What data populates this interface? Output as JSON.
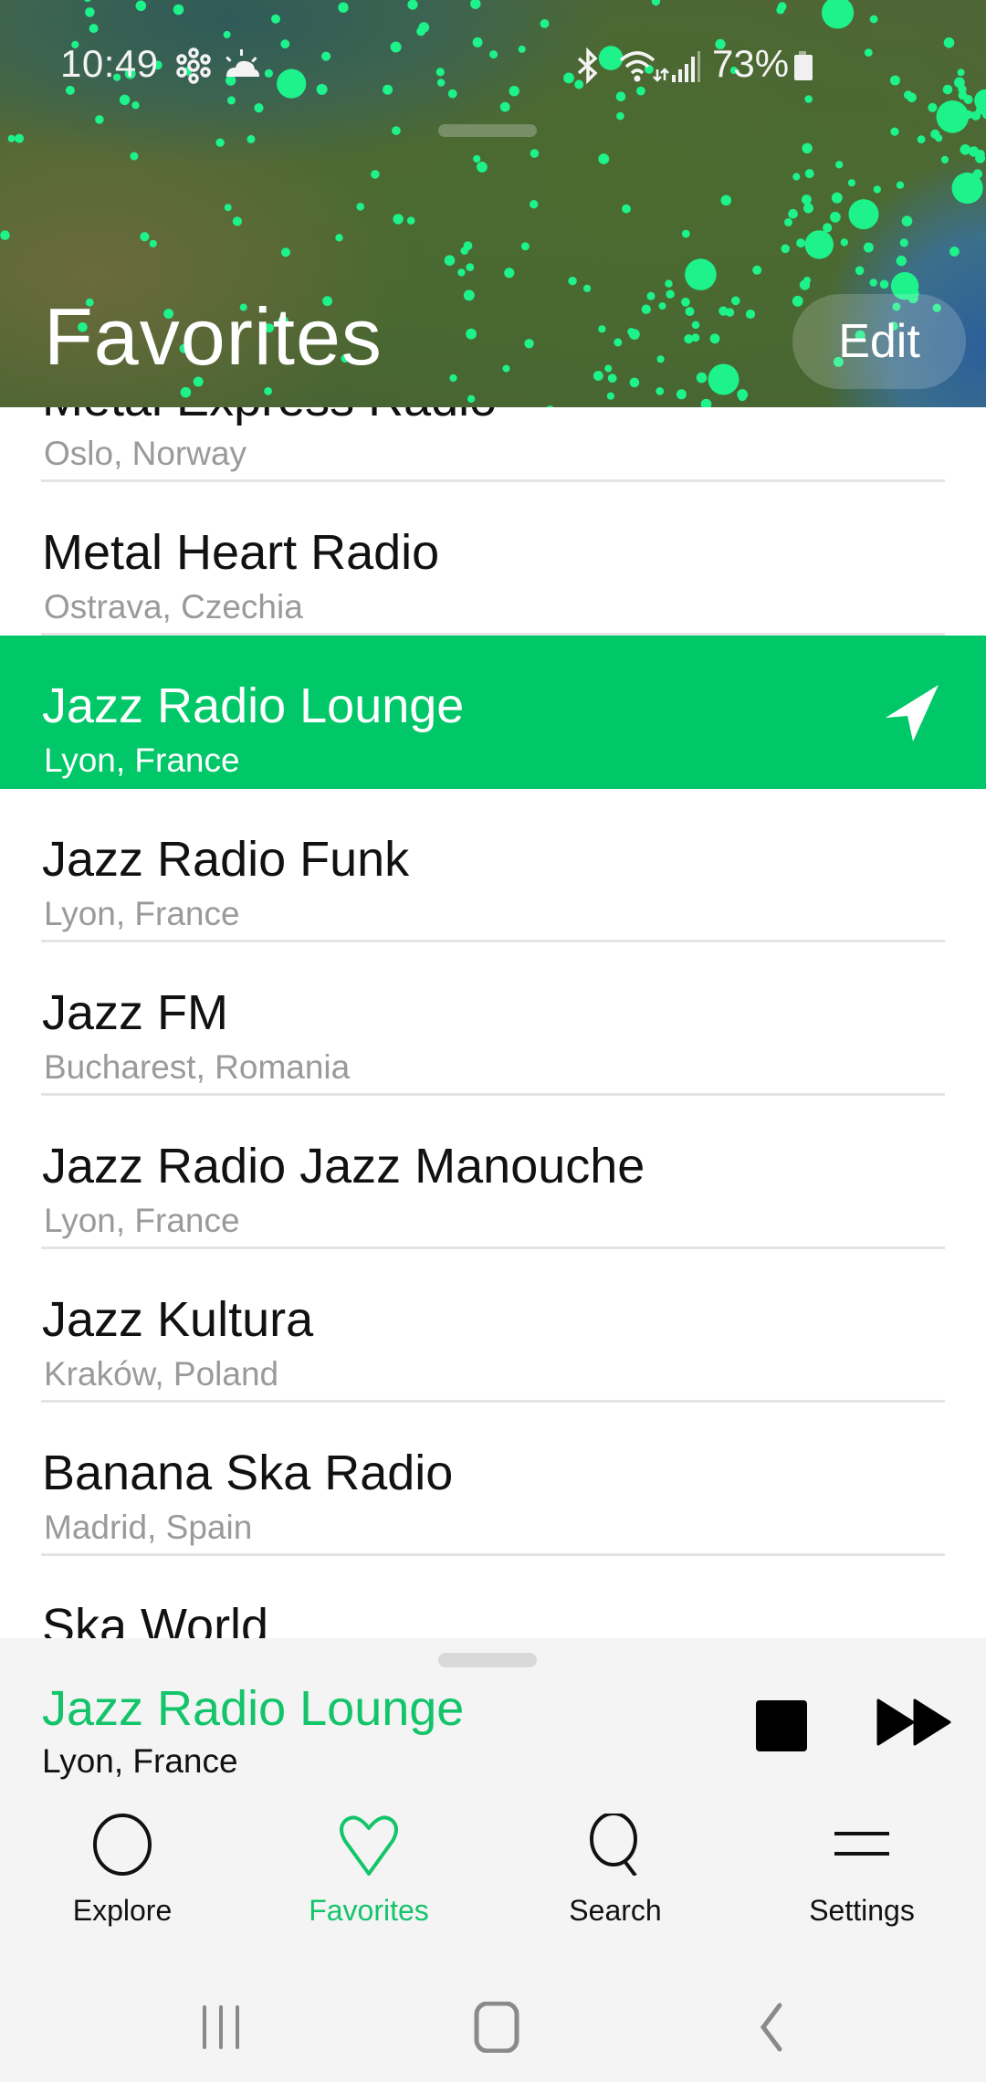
{
  "status_bar": {
    "time": "10:49",
    "left_icons": [
      "pinwheel-icon",
      "weather-sun-cloud-icon"
    ],
    "right_icons": [
      "bluetooth-icon",
      "wifi-data-icon",
      "signal-icon",
      "battery-icon"
    ],
    "battery_percent": "73%"
  },
  "header": {
    "title": "Favorites",
    "edit_label": "Edit",
    "background": "satellite-map-with-station-dots"
  },
  "colors": {
    "accent": "#00C767",
    "accent_text": "#14C46A",
    "map_dot": "#1EF28A"
  },
  "stations": [
    {
      "name": "Metal Express Radio",
      "location": "Oslo, Norway",
      "active": false
    },
    {
      "name": "Metal Heart Radio",
      "location": "Ostrava, Czechia",
      "active": false
    },
    {
      "name": "Jazz Radio Lounge",
      "location": "Lyon, France",
      "active": true,
      "icon": "navigation-arrow-icon"
    },
    {
      "name": "Jazz Radio Funk",
      "location": "Lyon, France",
      "active": false
    },
    {
      "name": "Jazz FM",
      "location": "Bucharest, Romania",
      "active": false
    },
    {
      "name": "Jazz Radio Jazz Manouche",
      "location": "Lyon, France",
      "active": false
    },
    {
      "name": "Jazz Kultura",
      "location": "Kraków, Poland",
      "active": false
    },
    {
      "name": "Banana Ska Radio",
      "location": "Madrid, Spain",
      "active": false
    },
    {
      "name": "Ska World",
      "location": "",
      "active": false
    }
  ],
  "player": {
    "title": "Jazz Radio Lounge",
    "location": "Lyon, France",
    "stop_icon": "stop-icon",
    "next_icon": "fast-forward-icon"
  },
  "tabs": [
    {
      "label": "Explore",
      "icon": "circle-icon",
      "active": false
    },
    {
      "label": "Favorites",
      "icon": "heart-icon",
      "active": true
    },
    {
      "label": "Search",
      "icon": "search-icon",
      "active": false
    },
    {
      "label": "Settings",
      "icon": "menu-icon",
      "active": false
    }
  ],
  "system_nav": [
    "recent-apps-icon",
    "home-icon",
    "back-icon"
  ]
}
